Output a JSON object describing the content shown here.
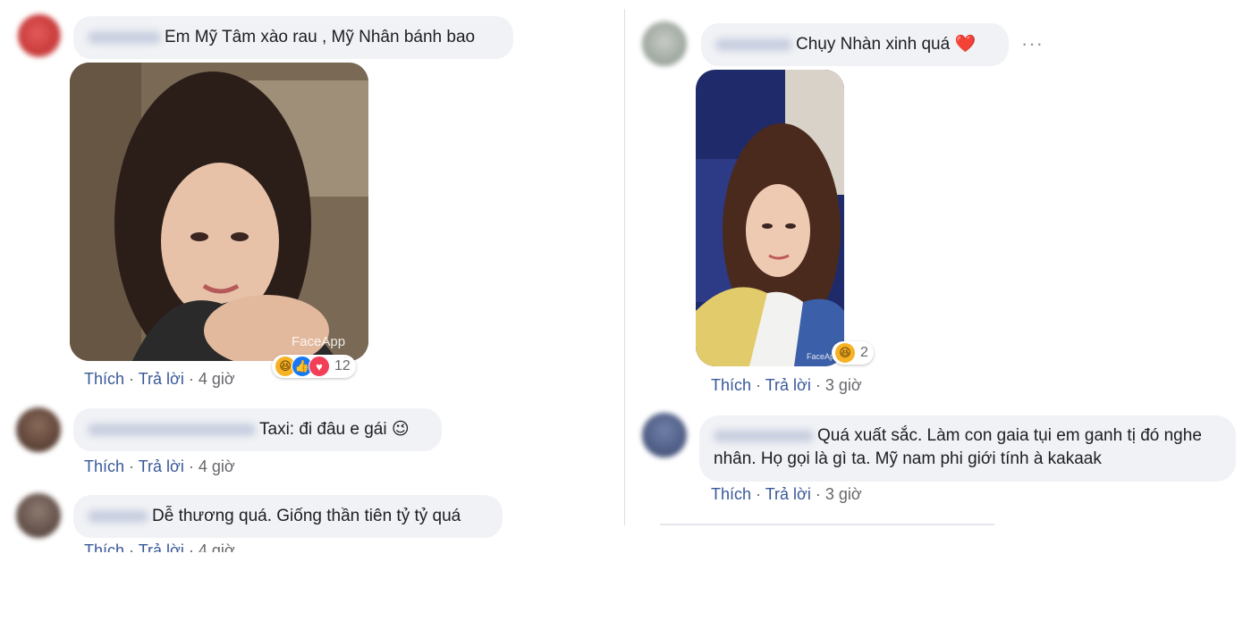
{
  "actions": {
    "like": "Thích",
    "reply": "Trả lời",
    "sep": " · "
  },
  "left_column": {
    "comments": [
      {
        "text": "Em Mỹ Tâm xào rau , Mỹ Nhân bánh bao",
        "time": "4 giờ",
        "image_watermark": "FaceApp",
        "reactions": {
          "icons": [
            "haha-icon",
            "like-icon",
            "love-icon"
          ],
          "count": "12"
        }
      },
      {
        "text": "Taxi: đi đâu e gái 😉",
        "time": "4 giờ"
      },
      {
        "text": "Dễ thương quá. Giống thần tiên tỷ tỷ quá",
        "time": "4 giờ"
      }
    ]
  },
  "right_column": {
    "comments": [
      {
        "text": "Chụy Nhàn xinh quá ❤️",
        "time": "3 giờ",
        "more": "···",
        "image_watermark": "FaceApp",
        "reactions": {
          "icons": [
            "haha-icon"
          ],
          "count": "2"
        }
      },
      {
        "text_line1": "Quá xuất sắc. Làm con gaia tụi em ganh tị đó nghe",
        "text_line2": "nhân. Họ gọi là gì ta. Mỹ nam phi giới tính à kakaak",
        "time": "3 giờ"
      }
    ]
  },
  "colors": {
    "bubble": "#f0f2f5",
    "like_link": "#385898",
    "meta": "#65676b"
  }
}
